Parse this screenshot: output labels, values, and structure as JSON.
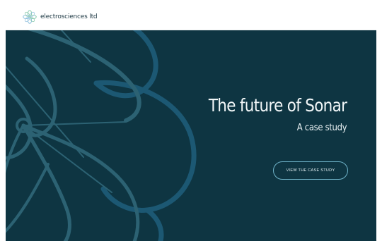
{
  "header": {
    "logo_text": "electrosciences ltd",
    "logo_icon": "flower-logo-icon"
  },
  "hero": {
    "title": "The future of Sonar",
    "subtitle": "A case study",
    "cta_label": "VIEW THE CASE STUDY",
    "decoration_icon": "flower-outline-graphic"
  },
  "colors": {
    "hero_background": "#0e3542",
    "hero_line_light": "#2c6273",
    "hero_line_blue": "#1c5873",
    "button_border": "#6fb3c9",
    "logo_green": "#7cc4a6",
    "logo_blue": "#7fb9d9",
    "text_light": "#f2f7f8"
  }
}
